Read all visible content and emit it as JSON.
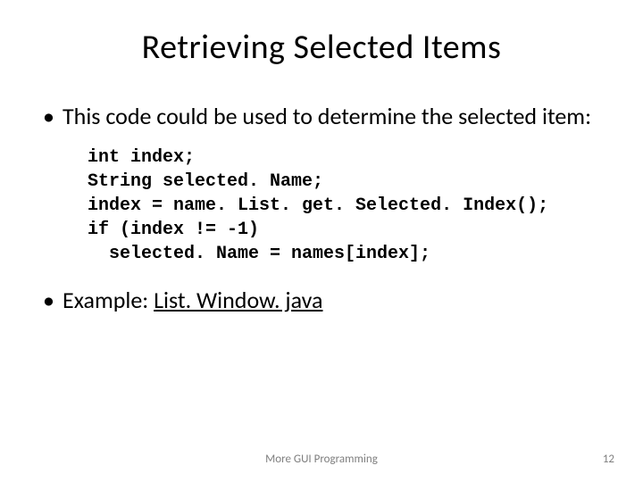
{
  "title": "Retrieving Selected Items",
  "bullets": {
    "item1": "This code could be used to determine the selected item:",
    "item2_prefix": "Example: ",
    "item2_link": "List. Window. java"
  },
  "code": {
    "line1": "int index;",
    "line2": "String selected. Name;",
    "line3": "index = name. List. get. Selected. Index();",
    "line4": "if (index != -1)",
    "line5": "  selected. Name = names[index];"
  },
  "footer": {
    "text": "More GUI Programming",
    "page": "12"
  }
}
